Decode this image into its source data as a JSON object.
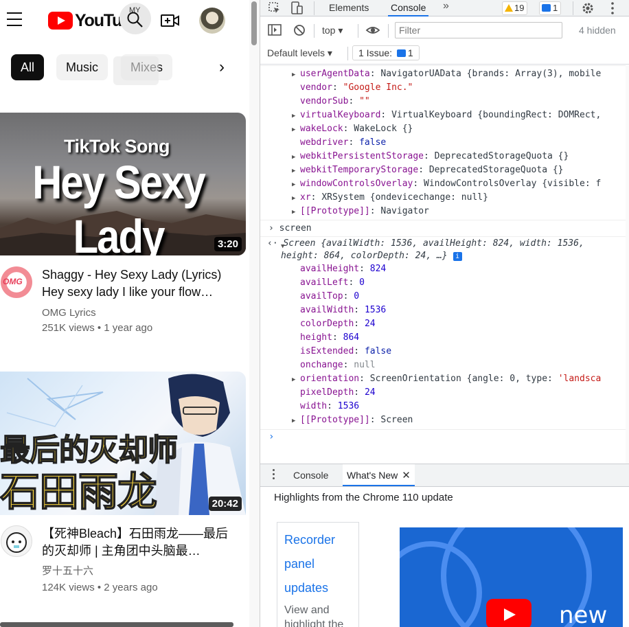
{
  "youtube": {
    "logo_text": "YouTube",
    "search_badge": "MY",
    "chips": [
      "All",
      "Music",
      "Mixes"
    ],
    "videos": [
      {
        "thumb_small": "TikTok Song",
        "thumb_big": "Hey Sexy Lady",
        "duration": "3:20",
        "channel_avatar_text": "OMG",
        "title": "Shaggy - Hey Sexy Lady (Lyrics) Hey sexy lady I like your flow…",
        "channel": "OMG Lyrics",
        "stats": "251K views • 1 year ago"
      },
      {
        "thumb_line1": "最后的灭却师",
        "thumb_line2": "石田雨龙",
        "duration": "20:42",
        "title": "【死神Bleach】石田雨龙——最后的灭却师 | 主角团中头脑最…",
        "channel": "罗十五十六",
        "stats": "124K views • 2 years ago"
      }
    ]
  },
  "devtools": {
    "tabs": [
      "Elements",
      "Console"
    ],
    "active_tab": "Console",
    "warnings_count": "19",
    "messages_count": "1",
    "context": "top",
    "filter_placeholder": "Filter",
    "hidden_count": "4 hidden",
    "levels": "Default levels",
    "issues_label": "1 Issue:",
    "issues_count": "1",
    "navigator_lines": [
      {
        "arrow": "▶",
        "key": "userAgentData",
        "sep": ": ",
        "rest": "NavigatorUAData {brands: Array(3), mobile"
      },
      {
        "arrow": "",
        "key": "vendor",
        "sep": ": ",
        "str": "\"Google Inc.\""
      },
      {
        "arrow": "",
        "key": "vendorSub",
        "sep": ": ",
        "str": "\"\""
      },
      {
        "arrow": "▶",
        "key": "virtualKeyboard",
        "sep": ": ",
        "rest": "VirtualKeyboard {boundingRect: DOMRect,"
      },
      {
        "arrow": "▶",
        "key": "wakeLock",
        "sep": ": ",
        "rest": "WakeLock {}"
      },
      {
        "arrow": "",
        "key": "webdriver",
        "sep": ": ",
        "kw": "false"
      },
      {
        "arrow": "▶",
        "key": "webkitPersistentStorage",
        "sep": ": ",
        "rest": "DeprecatedStorageQuota {}"
      },
      {
        "arrow": "▶",
        "key": "webkitTemporaryStorage",
        "sep": ": ",
        "rest": "DeprecatedStorageQuota {}"
      },
      {
        "arrow": "▶",
        "key": "windowControlsOverlay",
        "sep": ": ",
        "rest": "WindowControlsOverlay {visible: f"
      },
      {
        "arrow": "▶",
        "key": "xr",
        "sep": ": ",
        "rest": "XRSystem {ondevicechange: null}"
      },
      {
        "arrow": "▶",
        "key": "[[Prototype]]",
        "sep": ": ",
        "rest": "Navigator"
      }
    ],
    "input_command": "screen",
    "screen_summary_line1": "Screen {availWidth: 1536, availHeight: 824, width: 1536,",
    "screen_summary_line2": "height: 864, colorDepth: 24, …}",
    "screen_lines": [
      {
        "arrow": "",
        "key": "availHeight",
        "sep": ": ",
        "num": "824"
      },
      {
        "arrow": "",
        "key": "availLeft",
        "sep": ": ",
        "num": "0"
      },
      {
        "arrow": "",
        "key": "availTop",
        "sep": ": ",
        "num": "0"
      },
      {
        "arrow": "",
        "key": "availWidth",
        "sep": ": ",
        "num": "1536"
      },
      {
        "arrow": "",
        "key": "colorDepth",
        "sep": ": ",
        "num": "24"
      },
      {
        "arrow": "",
        "key": "height",
        "sep": ": ",
        "num": "864"
      },
      {
        "arrow": "",
        "key": "isExtended",
        "sep": ": ",
        "kw": "false"
      },
      {
        "arrow": "",
        "key": "onchange",
        "sep": ": ",
        "nul": "null"
      },
      {
        "arrow": "▶",
        "key": "orientation",
        "sep": ": ",
        "rest": "ScreenOrientation {angle: 0, type: ",
        "str": "'landsca"
      },
      {
        "arrow": "",
        "key": "pixelDepth",
        "sep": ": ",
        "num": "24"
      },
      {
        "arrow": "",
        "key": "width",
        "sep": ": ",
        "num": "1536"
      },
      {
        "arrow": "▶",
        "key": "[[Prototype]]",
        "sep": ": ",
        "rest": "Screen"
      }
    ],
    "drawer_tabs": [
      "Console",
      "What's New"
    ],
    "drawer_active": "What's New",
    "highlights": "Highlights from the Chrome 110 update",
    "whats_new": {
      "links": [
        "Recorder",
        "panel",
        "updates"
      ],
      "desc": "View and highlight the",
      "image_text": "new"
    }
  }
}
